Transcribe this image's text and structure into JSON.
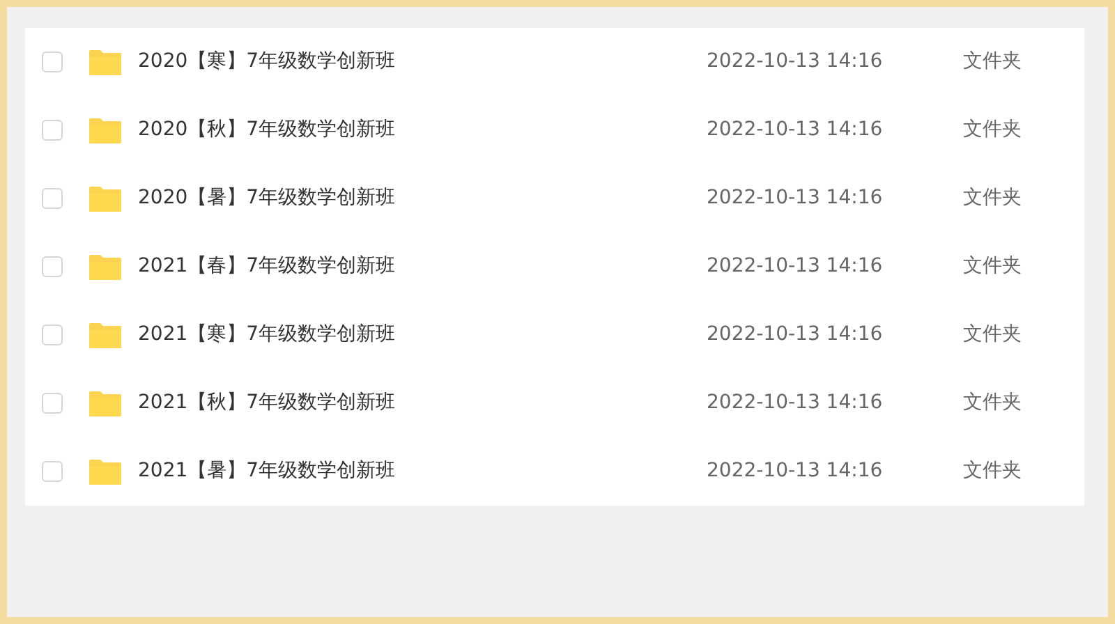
{
  "files": [
    {
      "name": "2020【寒】7年级数学创新班",
      "modified": "2022-10-13 14:16",
      "type": "文件夹",
      "checked": false
    },
    {
      "name": "2020【秋】7年级数学创新班",
      "modified": "2022-10-13 14:16",
      "type": "文件夹",
      "checked": false
    },
    {
      "name": "2020【暑】7年级数学创新班",
      "modified": "2022-10-13 14:16",
      "type": "文件夹",
      "checked": false
    },
    {
      "name": "2021【春】7年级数学创新班",
      "modified": "2022-10-13 14:16",
      "type": "文件夹",
      "checked": false
    },
    {
      "name": "2021【寒】7年级数学创新班",
      "modified": "2022-10-13 14:16",
      "type": "文件夹",
      "checked": false
    },
    {
      "name": "2021【秋】7年级数学创新班",
      "modified": "2022-10-13 14:16",
      "type": "文件夹",
      "checked": false
    },
    {
      "name": "2021【暑】7年级数学创新班",
      "modified": "2022-10-13 14:16",
      "type": "文件夹",
      "checked": false
    }
  ]
}
